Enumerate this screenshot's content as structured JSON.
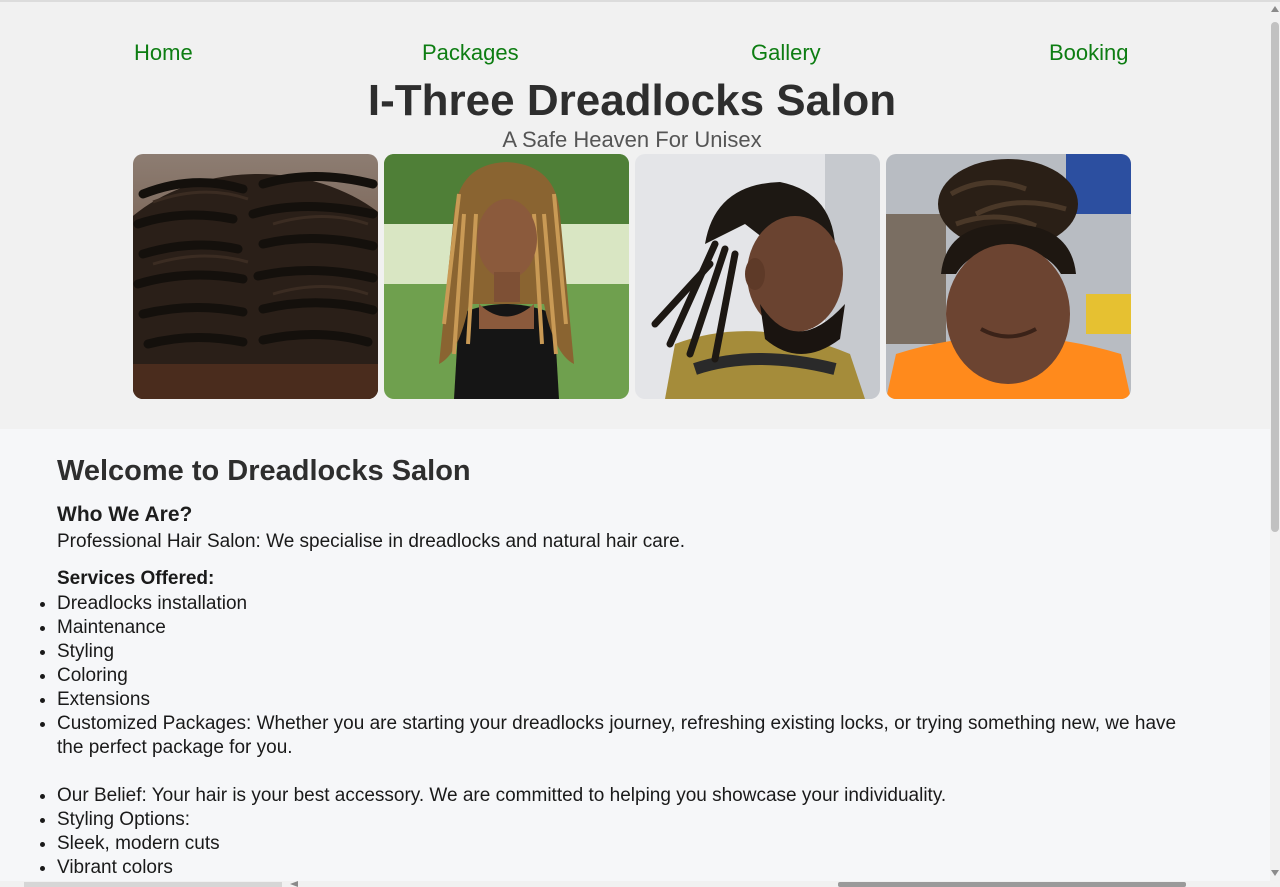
{
  "nav": [
    {
      "label": "Home"
    },
    {
      "label": "Packages"
    },
    {
      "label": "Gallery"
    },
    {
      "label": "Booking"
    }
  ],
  "header": {
    "title": "I-Three Dreadlocks Salon",
    "subtitle": "A Safe Heaven For Unisex"
  },
  "main": {
    "heading": "Welcome to Dreadlocks Salon",
    "who_heading": "Who We Are?",
    "intro": "Professional Hair Salon: We specialise in dreadlocks and natural hair care.",
    "services_title": "Services Offered:",
    "services": [
      "Dreadlocks installation",
      "Maintenance",
      "Styling",
      "Coloring",
      "Extensions",
      "Customized Packages: Whether you are starting your dreadlocks journey, refreshing existing locks, or trying something new, we have the perfect package for you."
    ],
    "more": [
      "Our Belief: Your hair is your best accessory. We are committed to helping you showcase your individuality.",
      "Styling Options:",
      "Sleek, modern cuts",
      "Vibrant colors"
    ]
  },
  "colors": {
    "nav_link": "#0d7d12",
    "header_bg": "#f1f1f1",
    "page_bg": "#f6f7f9",
    "title": "#2e2e2e"
  }
}
